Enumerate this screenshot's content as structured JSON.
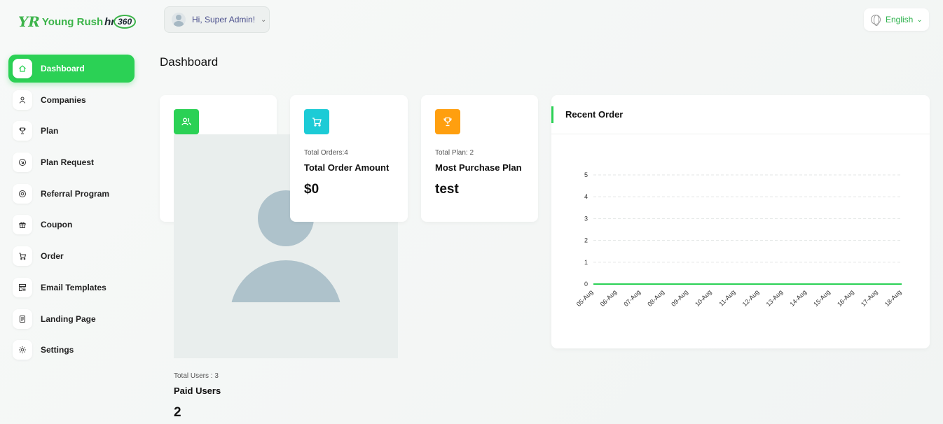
{
  "brand": {
    "mark": "YR",
    "name": "Young Rush",
    "suffix_hr": "hr",
    "suffix_360": "360"
  },
  "header": {
    "user_greeting": "Hi, Super Admin!",
    "language": "English"
  },
  "sidebar": {
    "items": [
      {
        "label": "Dashboard",
        "icon": "home-icon",
        "active": true
      },
      {
        "label": "Companies",
        "icon": "user-icon",
        "active": false
      },
      {
        "label": "Plan",
        "icon": "trophy-icon",
        "active": false
      },
      {
        "label": "Plan Request",
        "icon": "arrow-circle-icon",
        "active": false
      },
      {
        "label": "Referral Program",
        "icon": "badge-icon",
        "active": false
      },
      {
        "label": "Coupon",
        "icon": "gift-icon",
        "active": false
      },
      {
        "label": "Order",
        "icon": "cart-icon",
        "active": false
      },
      {
        "label": "Email Templates",
        "icon": "template-icon",
        "active": false
      },
      {
        "label": "Landing Page",
        "icon": "page-icon",
        "active": false
      },
      {
        "label": "Settings",
        "icon": "gear-icon",
        "active": false
      }
    ]
  },
  "page": {
    "title": "Dashboard"
  },
  "cards": {
    "users": {
      "sub": "Total Users : 3",
      "title": "Paid Users",
      "value": "2",
      "icon_color": "#2bd155"
    },
    "orders": {
      "sub": "Total Orders:4",
      "title": "Total Order Amount",
      "value": "$0",
      "icon_color": "#1ccbd6"
    },
    "plan": {
      "sub": "Total Plan: 2",
      "title": "Most Purchase Plan",
      "value": "test",
      "icon_color": "#ff9f0f"
    }
  },
  "recent_order": {
    "title": "Recent Order"
  },
  "chart_data": {
    "type": "line",
    "title": "Recent Order",
    "x": [
      "05-Aug",
      "06-Aug",
      "07-Aug",
      "08-Aug",
      "09-Aug",
      "10-Aug",
      "11-Aug",
      "12-Aug",
      "13-Aug",
      "14-Aug",
      "15-Aug",
      "16-Aug",
      "17-Aug",
      "18-Aug"
    ],
    "series": [
      {
        "values": [
          0,
          0,
          0,
          0,
          0,
          0,
          0,
          0,
          0,
          0,
          0,
          0,
          0,
          0
        ]
      }
    ],
    "ylim": [
      0,
      5
    ],
    "yticks": [
      0,
      1,
      2,
      3,
      4,
      5
    ],
    "grid": true,
    "color": "#2bd155"
  },
  "colors": {
    "accent": "#2bd155",
    "brand": "#3cb44a"
  }
}
